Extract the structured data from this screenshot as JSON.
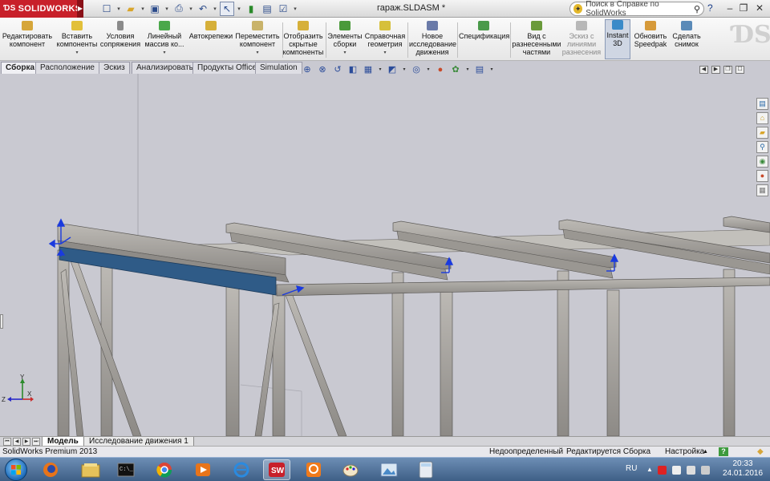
{
  "titlebar": {
    "app_name": "SOLIDWORKS",
    "document_title": "гараж.SLDASM *",
    "search_placeholder": "Поиск в Справке по SolidWorks",
    "help_symbol": "?"
  },
  "ribbon": {
    "buttons": [
      {
        "label": "Редактировать компонент"
      },
      {
        "label": "Вставить компоненты"
      },
      {
        "label": "Условия сопряжения"
      },
      {
        "label": "Линейный массив ко..."
      },
      {
        "label": "Автокрепежи"
      },
      {
        "label": "Переместить компонент"
      },
      {
        "label": "Отобразить скрытые компоненты"
      },
      {
        "label": "Элементы сборки"
      },
      {
        "label": "Справочная геометрия"
      },
      {
        "label": "Новое исследование движения"
      },
      {
        "label": "Спецификация"
      },
      {
        "label": "Вид с разнесенными частями"
      },
      {
        "label": "Эскиз с линиями разнесения"
      },
      {
        "label": "Instant 3D"
      },
      {
        "label": "Обновить Speedpak"
      },
      {
        "label": "Сделать снимок"
      }
    ]
  },
  "tabs": [
    {
      "label": "Сборка",
      "active": true
    },
    {
      "label": "Расположение"
    },
    {
      "label": "Эскиз"
    },
    {
      "label": "Анализировать"
    },
    {
      "label": "Продукты Office"
    },
    {
      "label": "Simulation"
    }
  ],
  "triad": {
    "x": "X",
    "y": "Y",
    "z": "Z"
  },
  "model_tabs": [
    {
      "label": "Модель",
      "active": true
    },
    {
      "label": "Исследование движения 1"
    }
  ],
  "statusbar": {
    "product": "SolidWorks Premium 2013",
    "definition": "Недоопределенный",
    "mode": "Редактируется Сборка",
    "customize": "Настройка",
    "help": "?"
  },
  "taskbar": {
    "language": "RU",
    "time": "20:33",
    "date": "24.01.2016"
  },
  "colors": {
    "viewport_bg": "#c9c9d1",
    "steel": "#a9a6a1",
    "selected_beam": "#2f5b87",
    "brand_red": "#c8202a"
  }
}
